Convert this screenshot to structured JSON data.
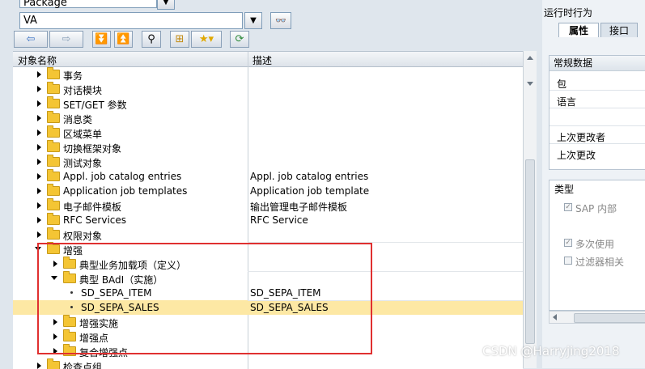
{
  "top": {
    "type_combo_value": "Package",
    "object_input_value": "VA"
  },
  "toolbar": {
    "icons": [
      "back-icon",
      "forward-icon",
      "expand-icon",
      "collapse-icon",
      "binoculars-icon",
      "hierarchy-icon",
      "favorites-icon",
      "refresh-icon"
    ]
  },
  "tree": {
    "col_name_header": "对象名称",
    "col_desc_header": "描述",
    "rows": [
      {
        "name": "事务",
        "desc": "",
        "level": 1,
        "node": "collapsed",
        "icon": "folder"
      },
      {
        "name": "对话模块",
        "desc": "",
        "level": 1,
        "node": "collapsed",
        "icon": "folder"
      },
      {
        "name": "SET/GET 参数",
        "desc": "",
        "level": 1,
        "node": "collapsed",
        "icon": "folder"
      },
      {
        "name": "消息类",
        "desc": "",
        "level": 1,
        "node": "collapsed",
        "icon": "folder"
      },
      {
        "name": "区域菜单",
        "desc": "",
        "level": 1,
        "node": "collapsed",
        "icon": "folder"
      },
      {
        "name": "切换框架对象",
        "desc": "",
        "level": 1,
        "node": "collapsed",
        "icon": "folder"
      },
      {
        "name": "测试对象",
        "desc": "",
        "level": 1,
        "node": "collapsed",
        "icon": "folder"
      },
      {
        "name": "Appl. job catalog entries",
        "desc": "Appl. job catalog entries",
        "level": 1,
        "node": "collapsed",
        "icon": "folder"
      },
      {
        "name": "Application job templates",
        "desc": "Application job template",
        "level": 1,
        "node": "collapsed",
        "icon": "folder"
      },
      {
        "name": "电子邮件模板",
        "desc": "输出管理电子邮件模板",
        "level": 1,
        "node": "collapsed",
        "icon": "folder"
      },
      {
        "name": "RFC Services",
        "desc": "RFC Service",
        "level": 1,
        "node": "collapsed",
        "icon": "folder"
      },
      {
        "name": "权限对象",
        "desc": "",
        "level": 1,
        "node": "collapsed",
        "icon": "folder"
      },
      {
        "name": "增强",
        "desc": "",
        "level": 1,
        "node": "expanded",
        "icon": "folder"
      },
      {
        "name": "典型业务加载项（定义）",
        "desc": "",
        "level": 2,
        "node": "collapsed",
        "icon": "folder"
      },
      {
        "name": "典型 BAdI（实施）",
        "desc": "",
        "level": 2,
        "node": "expanded",
        "icon": "folder"
      },
      {
        "name": "SD_SEPA_ITEM",
        "desc": "SD_SEPA_ITEM",
        "level": 3,
        "node": "leaf",
        "icon": "none"
      },
      {
        "name": "SD_SEPA_SALES",
        "desc": "SD_SEPA_SALES",
        "level": 3,
        "node": "leaf",
        "icon": "none",
        "selected": true
      },
      {
        "name": "增强实施",
        "desc": "",
        "level": 2,
        "node": "collapsed",
        "icon": "folder"
      },
      {
        "name": "增强点",
        "desc": "",
        "level": 2,
        "node": "collapsed",
        "icon": "folder"
      },
      {
        "name": "复合增强点",
        "desc": "",
        "level": 2,
        "node": "collapsed",
        "icon": "folder"
      },
      {
        "name": "检查点组",
        "desc": "",
        "level": 1,
        "node": "collapsed",
        "icon": "folder"
      }
    ]
  },
  "right_panel": {
    "title": "运行时行为",
    "tabs": [
      {
        "label": "属性",
        "active": true
      },
      {
        "label": "接口",
        "active": false
      }
    ],
    "general_group": {
      "title": "常规数据",
      "fields": [
        "包",
        "语言",
        "上次更改者",
        "上次更改"
      ]
    },
    "type_group": {
      "title": "类型",
      "checkboxes": [
        {
          "label": "SAP 内部",
          "checked": true
        },
        {
          "label": "多次使用",
          "checked": true
        },
        {
          "label": "过滤器相关",
          "checked": false
        }
      ]
    }
  },
  "watermark": "CSDN @Harryjing2018",
  "colors": {
    "selected_row": "#fde8a4",
    "highlight_box": "#e03030",
    "folder": "#f4c534"
  }
}
